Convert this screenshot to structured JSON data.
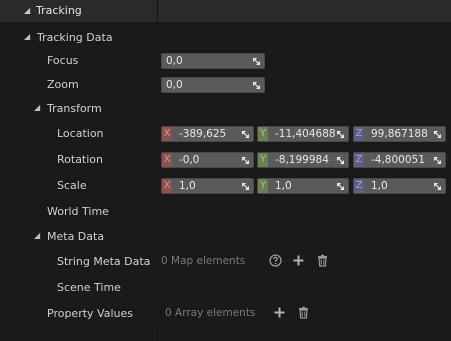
{
  "header": {
    "title": "Tracking"
  },
  "tree": {
    "tracking_data": "Tracking Data",
    "focus": {
      "label": "Focus",
      "value": "0,0"
    },
    "zoom": {
      "label": "Zoom",
      "value": "0,0"
    },
    "transform": "Transform",
    "location": {
      "label": "Location",
      "x": "-389,625",
      "y": "-11,404688",
      "z": "99,867188"
    },
    "rotation": {
      "label": "Rotation",
      "x": "-0,0",
      "y": "-8,199984",
      "z": "-4,800051"
    },
    "scale": {
      "label": "Scale",
      "x": "1,0",
      "y": "1,0",
      "z": "1,0"
    },
    "world_time": "World Time",
    "meta_data": "Meta Data",
    "string_meta_data": {
      "label": "String Meta Data",
      "value": "0 Map elements"
    },
    "scene_time": "Scene Time",
    "property_values": {
      "label": "Property Values",
      "value": "0 Array elements"
    }
  },
  "axes": {
    "x": "X",
    "y": "Y",
    "z": "Z"
  },
  "colors": {
    "x_axis": "#be4646",
    "y_axis": "#78a050",
    "z_axis": "#5a64aa",
    "field_bg": "#5a5a5a",
    "panel_bg": "#1a1a1a"
  },
  "icons": [
    "collapse-triangle-icon",
    "drag-handle-icon",
    "help-icon",
    "add-icon",
    "trash-icon"
  ]
}
